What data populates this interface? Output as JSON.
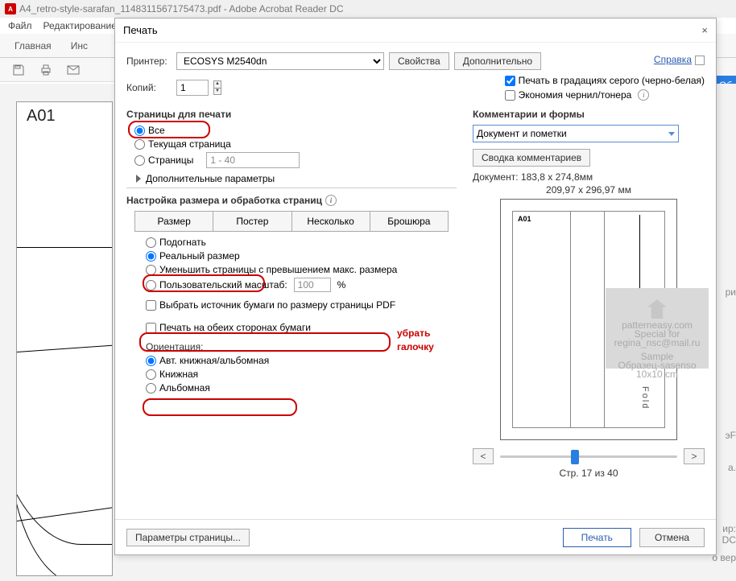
{
  "window": {
    "title": "A4_retro-style-sarafan_1148311567175473.pdf - Adobe Acrobat Reader DC"
  },
  "menu": {
    "file": "Файл",
    "edit": "Редактирование"
  },
  "tabs": {
    "home": "Главная",
    "tools": "Инс"
  },
  "blue_sliver": "Об",
  "doc_page": {
    "label": "A01"
  },
  "dialog": {
    "title": "Печать",
    "help": "Справка",
    "printer_label": "Принтер:",
    "printer_value": "ECOSYS M2540dn",
    "properties": "Свойства",
    "advanced": "Дополнительно",
    "copies_label": "Копий:",
    "copies_value": "1",
    "grayscale": "Печать в градациях серого (черно-белая)",
    "ink_save": "Экономия чернил/тонера",
    "pages_section": "Страницы для печати",
    "all": "Все",
    "current": "Текущая страница",
    "pages_radio": "Страницы",
    "pages_range": "1 - 40",
    "more": "Дополнительные параметры",
    "sizing_section": "Настройка размера и обработка страниц",
    "seg_size": "Размер",
    "seg_poster": "Постер",
    "seg_multi": "Несколько",
    "seg_booklet": "Брошюра",
    "fit": "Подогнать",
    "actual": "Реальный размер",
    "shrink": "Уменьшить страницы с превышением макс. размера",
    "custom_scale": "Пользовательский масштаб:",
    "custom_scale_val": "100",
    "choose_source": "Выбрать источник бумаги по размеру страницы PDF",
    "duplex": "Печать на обеих сторонах бумаги",
    "orientation_label": "Ориентация:",
    "orient_auto": "Авт. книжная/альбомная",
    "orient_portrait": "Книжная",
    "orient_landscape": "Альбомная",
    "comments_section": "Комментарии и формы",
    "comments_combo": "Документ и пометки",
    "summarize": "Сводка комментариев",
    "doc_dims": "Документ: 183,8 x 274,8мм",
    "paper_dims": "209,97 x 296,97 мм",
    "preview_a01": "A01",
    "fold": "Fold",
    "watermark": {
      "l1": "patterneasy.com",
      "l2": "Special for",
      "l3": "regina_nsc@mail.ru",
      "l4": "Sample",
      "l5": "Oбразец-sasenso",
      "l6": "10x10 cm"
    },
    "page_of": "Стр. 17 из 40",
    "page_setup": "Параметры страницы...",
    "print": "Печать",
    "cancel": "Отмена"
  },
  "annotation": {
    "line1": "убрать",
    "line2": "галочку"
  },
  "bg_snips": {
    "a": "ри",
    "b": "эF",
    "c": "а.",
    "d": "ир:",
    "e": "DC",
    "f": "о вер"
  }
}
